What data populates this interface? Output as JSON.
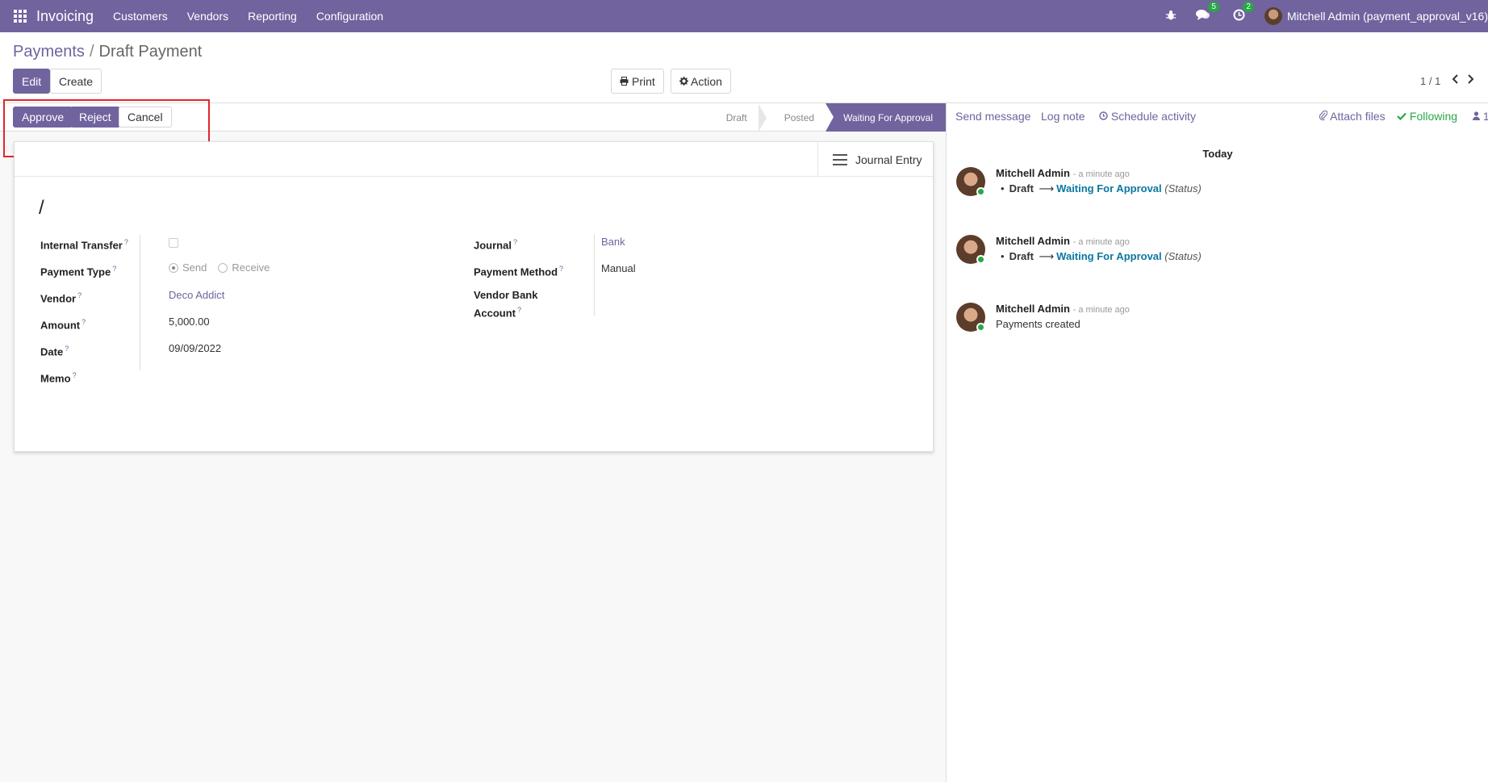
{
  "navbar": {
    "app_name": "Invoicing",
    "menu": [
      "Customers",
      "Vendors",
      "Reporting",
      "Configuration"
    ],
    "messages_badge": "5",
    "activities_badge": "2",
    "user": "Mitchell Admin (payment_approval_v16)"
  },
  "breadcrumb": {
    "parent": "Payments",
    "separator": "/",
    "current": "Draft Payment"
  },
  "control": {
    "edit": "Edit",
    "create": "Create",
    "print": "Print",
    "action": "Action",
    "pager": "1 / 1"
  },
  "statusbar": {
    "approve": "Approve",
    "reject": "Reject",
    "cancel": "Cancel",
    "steps": [
      "Draft",
      "Posted",
      "Waiting For Approval"
    ],
    "active_step": "Waiting For Approval"
  },
  "sheet": {
    "smart_button": "Journal Entry",
    "record_name": "/",
    "left_fields": [
      {
        "label": "Internal Transfer",
        "value": ""
      },
      {
        "label": "Payment Type",
        "options": [
          "Send",
          "Receive"
        ],
        "selected": "Send"
      },
      {
        "label": "Vendor",
        "value": "Deco Addict"
      },
      {
        "label": "Amount",
        "value": "5,000.00"
      },
      {
        "label": "Date",
        "value": "09/09/2022"
      },
      {
        "label": "Memo",
        "value": ""
      }
    ],
    "right_fields": [
      {
        "label": "Journal",
        "value": "Bank"
      },
      {
        "label": "Payment Method",
        "value": "Manual"
      },
      {
        "label": "Vendor Bank Account",
        "value": ""
      }
    ],
    "help_marker": "?"
  },
  "chatter": {
    "send_message": "Send message",
    "log_note": "Log note",
    "schedule_activity": "Schedule activity",
    "attach_files": "Attach files",
    "following": "Following",
    "followers_count": "1",
    "date_separator": "Today",
    "messages": [
      {
        "author": "Mitchell Admin",
        "time": "- a minute ago",
        "old": "Draft",
        "new": "Waiting For Approval",
        "field": "(Status)"
      },
      {
        "author": "Mitchell Admin",
        "time": "- a minute ago",
        "old": "Draft",
        "new": "Waiting For Approval",
        "field": "(Status)"
      },
      {
        "author": "Mitchell Admin",
        "time": "- a minute ago",
        "text": "Payments created"
      }
    ]
  },
  "colors": {
    "brand": "#71639e",
    "highlight": "#e0262c",
    "link_status": "#0b77a0",
    "following": "#28a745"
  }
}
